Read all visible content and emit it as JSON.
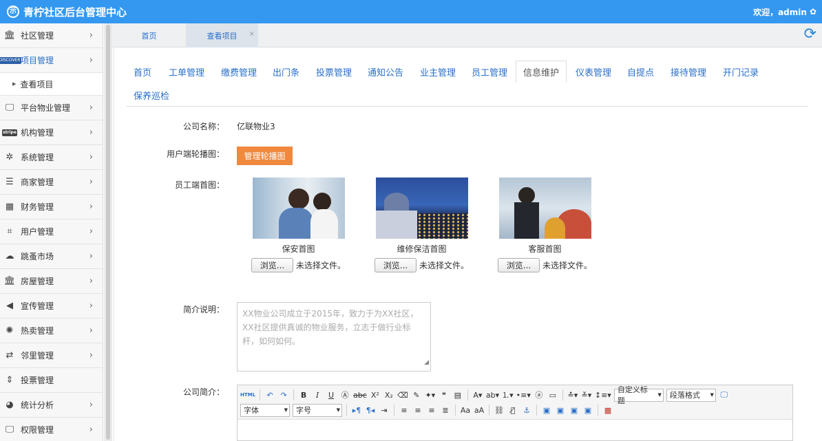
{
  "header": {
    "brand_logo": "示",
    "brand": "青柠社区后台管理中心",
    "welcome": "欢迎，admin"
  },
  "sidebar": {
    "items": [
      {
        "label": "社区管理",
        "icon": "bank-icon",
        "glyph": "🏛"
      },
      {
        "label": "项目管理",
        "icon": "discover-card-icon",
        "glyph": "DISCOVER",
        "active": true
      },
      {
        "label": "平台物业管理",
        "icon": "monitor-icon",
        "glyph": "🖵"
      },
      {
        "label": "机构管理",
        "icon": "stripe-icon",
        "glyph": "stripe"
      },
      {
        "label": "系统管理",
        "icon": "yelp-icon",
        "glyph": "✲"
      },
      {
        "label": "商家管理",
        "icon": "bars-icon",
        "glyph": "☰"
      },
      {
        "label": "财务管理",
        "icon": "calculator-icon",
        "glyph": "▦"
      },
      {
        "label": "用户管理",
        "icon": "crop-icon",
        "glyph": "⌗"
      },
      {
        "label": "跳蚤市场",
        "icon": "cloud-icon",
        "glyph": "☁"
      },
      {
        "label": "房屋管理",
        "icon": "bank-icon",
        "glyph": "🏛"
      },
      {
        "label": "宣传管理",
        "icon": "volume-icon",
        "glyph": "◀"
      },
      {
        "label": "热卖管理",
        "icon": "spinner-icon",
        "glyph": "✺"
      },
      {
        "label": "邻里管理",
        "icon": "retweet-icon",
        "glyph": "⇄"
      },
      {
        "label": "投票管理",
        "icon": "sort-icon",
        "glyph": "⇕"
      },
      {
        "label": "统计分析",
        "icon": "pie-chart-icon",
        "glyph": "◕"
      },
      {
        "label": "权限管理",
        "icon": "monitor-icon",
        "glyph": "🖵"
      }
    ],
    "sub_item": "查看项目"
  },
  "page_tabs": {
    "home": "首页",
    "current": "查看项目",
    "close": "×"
  },
  "subnav": [
    "首页",
    "工单管理",
    "缴费管理",
    "出门条",
    "投票管理",
    "通知公告",
    "业主管理",
    "员工管理",
    "信息维护",
    "仪表管理",
    "自提点",
    "接待管理",
    "开门记录",
    "保养巡检"
  ],
  "form": {
    "company_label": "公司名称：",
    "company_value": "亿联物业3",
    "carousel_label": "用户端轮播图：",
    "carousel_button": "管理轮播图",
    "staff_home_label": "员工端首图：",
    "images": [
      {
        "caption": "保安首图",
        "browse": "浏览...",
        "no_file": "未选择文件。"
      },
      {
        "caption": "维修保洁首图",
        "browse": "浏览...",
        "no_file": "未选择文件。"
      },
      {
        "caption": "客服首图",
        "browse": "浏览...",
        "no_file": "未选择文件。"
      }
    ],
    "intro_label": "简介说明：",
    "intro_placeholder": "XX物业公司成立于2015年，致力于为XX社区，XX社区提供真诚的物业服务，立志于做行业标杆，如何如何。",
    "profile_label": "公司简介："
  },
  "editor": {
    "html_label": "HTML",
    "custom_title": "自定义标题",
    "paragraph_format": "段落格式",
    "font_family": "字体",
    "font_size": "字号"
  },
  "colors": {
    "header": "#3498f0",
    "link": "#2a6fc9",
    "accent_button": "#f0883e"
  }
}
